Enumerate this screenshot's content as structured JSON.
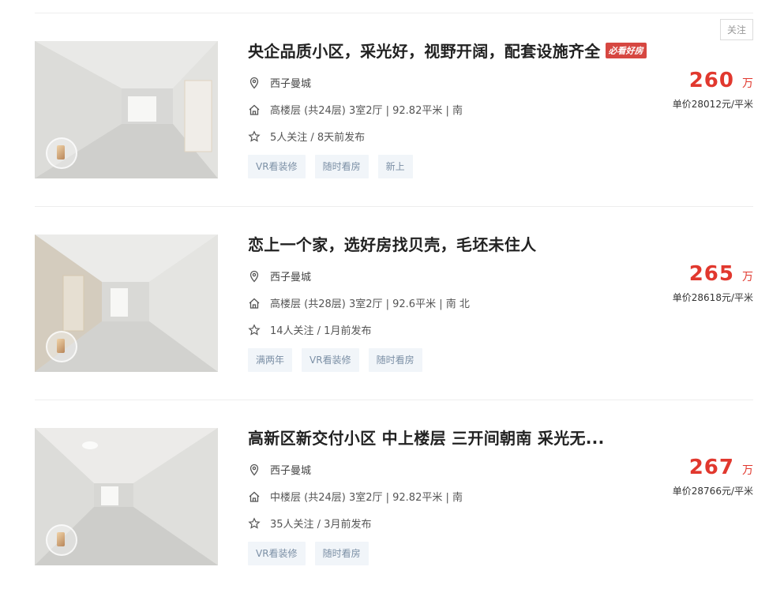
{
  "follow_button_label": "关注",
  "listings": [
    {
      "title": "央企品质小区，采光好，视野开阔，配套设施齐全",
      "hot_tag": "必看好房",
      "location": "西子曼城",
      "house_info": "高楼层 (共24层) 3室2厅 | 92.82平米 | 南",
      "follow_info": "5人关注 / 8天前发布",
      "tags": [
        "VR看装修",
        "随时看房",
        "新上"
      ],
      "total_price": "260",
      "price_unit": "万",
      "unit_price": "单价28012元/平米"
    },
    {
      "title": "恋上一个家，选好房找贝壳，毛坯未住人",
      "hot_tag": "",
      "location": "西子曼城",
      "house_info": "高楼层 (共28层) 3室2厅 | 92.6平米 | 南 北",
      "follow_info": "14人关注 / 1月前发布",
      "tags": [
        "满两年",
        "VR看装修",
        "随时看房"
      ],
      "total_price": "265",
      "price_unit": "万",
      "unit_price": "单价28618元/平米"
    },
    {
      "title": "高新区新交付小区 中上楼层 三开间朝南 采光无...",
      "hot_tag": "",
      "location": "西子曼城",
      "house_info": "中楼层 (共24层) 3室2厅 | 92.82平米 | 南",
      "follow_info": "35人关注 / 3月前发布",
      "tags": [
        "VR看装修",
        "随时看房"
      ],
      "total_price": "267",
      "price_unit": "万",
      "unit_price": "单价28766元/平米"
    }
  ],
  "icons": {
    "location": "location-pin-icon",
    "house": "house-icon",
    "star": "star-icon",
    "vr": "vr-badge-icon"
  },
  "colors": {
    "price": "#e1382e",
    "hot_tag_bg": "#d64741",
    "tag_bg": "#f1f5f9",
    "tag_text": "#7b8fa5"
  }
}
